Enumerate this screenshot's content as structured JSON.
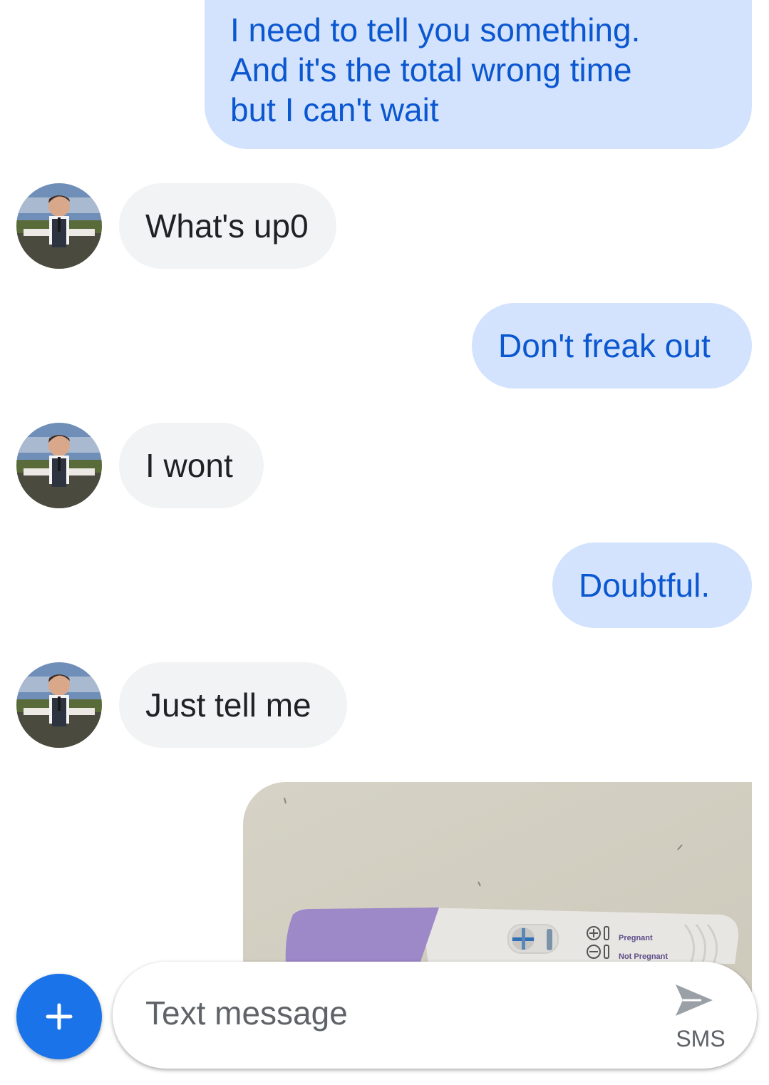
{
  "conversation": {
    "messages": [
      {
        "direction": "outgoing",
        "lines": [
          "I need to tell you something.",
          "And it's the total wrong time",
          "but I can't wait"
        ]
      },
      {
        "direction": "incoming",
        "text": "What's up0",
        "avatar": "contact-avatar"
      },
      {
        "direction": "outgoing",
        "text": "Don't freak out"
      },
      {
        "direction": "incoming",
        "text": "I wont",
        "avatar": "contact-avatar"
      },
      {
        "direction": "outgoing",
        "text": "Doubtful."
      },
      {
        "direction": "incoming",
        "text": "Just tell me",
        "avatar": "contact-avatar"
      },
      {
        "direction": "outgoing",
        "type": "image",
        "image": {
          "subject": "pregnancy test",
          "legend_positive": "Pregnant",
          "legend_negative": "Not Pregnant"
        }
      }
    ]
  },
  "composer": {
    "placeholder": "Text message",
    "send_label": "SMS",
    "add_icon": "plus-icon",
    "send_icon": "send-icon"
  },
  "colors": {
    "outgoing_bubble": "#d3e3fd",
    "outgoing_text": "#0b57d0",
    "incoming_bubble": "#f1f3f4",
    "incoming_text": "#202124",
    "accent": "#1a73e8"
  }
}
